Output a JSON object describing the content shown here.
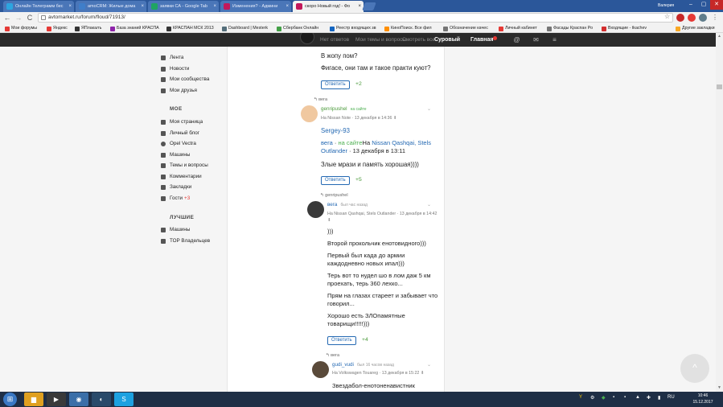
{
  "browser": {
    "tabs": [
      {
        "label": "Онлайн Телеграмм бес",
        "icon": "telegram-icon",
        "color": "#2ca5e0"
      },
      {
        "label": "amoCRM: Жилые дома",
        "icon": "amocrm-icon",
        "color": "#3f7ec9"
      },
      {
        "label": "заявки СА - Google Tab",
        "icon": "sheets-icon",
        "color": "#1fa463"
      },
      {
        "label": "Изменения? - Админи",
        "icon": "avtomarket-icon",
        "color": "#c2185b"
      },
      {
        "label": "скоро Новый год! - Фо",
        "icon": "avtomarket-icon",
        "color": "#c2185b"
      }
    ],
    "close_glyph": "×",
    "profile_name": "Валерия",
    "window_controls": [
      "–",
      "▢",
      "✕"
    ],
    "nav": {
      "back": "←",
      "forward": "→",
      "reload": "C"
    },
    "url": "avtomarket.ru/forum/floud/71913/",
    "star_glyph": "☆",
    "bookmarks": [
      {
        "label": "Мои форумы",
        "color": "#e53935"
      },
      {
        "label": "Яндекс",
        "color": "#e53935"
      },
      {
        "label": "ЯПлакалъ",
        "color": "#333333"
      },
      {
        "label": "База знаний КРАСПА",
        "color": "#8e24aa"
      },
      {
        "label": "КРАСПАН МСК 2013",
        "color": "#333333"
      },
      {
        "label": "Dashboard | Mesterk",
        "color": "#546e7a"
      },
      {
        "label": "Сбербанк Онлайн",
        "color": "#43a047"
      },
      {
        "label": "Реестр входящих зв",
        "color": "#1565c0"
      },
      {
        "label": "КиноПоиск. Все фил",
        "color": "#ff8f00"
      },
      {
        "label": "Обозначение качес",
        "color": "#757575"
      },
      {
        "label": "Личный кабинет",
        "color": "#e53935"
      },
      {
        "label": "Фасады Краспан Ро",
        "color": "#757575"
      },
      {
        "label": "Входящие - tkachev",
        "color": "#d32f2f"
      },
      {
        "label": "Другие закладки",
        "color": "#f9a825"
      }
    ]
  },
  "site": {
    "header": {
      "faded_links": [
        "Нет ответов",
        "Мои темы и вопросы",
        "Смотреть все"
      ],
      "user": "Суровый",
      "main": "Главная"
    },
    "sidebar": {
      "group1": [
        "Лента",
        "Новости",
        "Мои сообщества",
        "Мои друзья"
      ],
      "head_me": "МОЕ",
      "group2": [
        "Моя страница",
        "Личный блог",
        "Opel Vectra",
        "Машины",
        "Темы и вопросы",
        "Комментарии",
        "Закладки"
      ],
      "guests": {
        "label": "Гости",
        "count": "+3"
      },
      "head_best": "ЛУЧШИЕ",
      "group3": [
        "Машины",
        "ТОР Владельцев"
      ]
    },
    "comments": {
      "c0": {
        "line1": "В жопу пом?",
        "line2": "Фигасе, они там и такое практи куют?",
        "reply": "Ответить",
        "score": "+2"
      },
      "c1": {
        "reply_to": "вега",
        "author": "genripushel",
        "online": "на сайте",
        "meta_prefix": "На",
        "car": "Nissan Note",
        "date": "13 декабря в 14:36",
        "quote_user": "Sergey-93",
        "nested_user": "вега",
        "nested_online": "на сайте",
        "nested_prefix": "На",
        "nested_car": "Nissan Qashqai, Stels Outlander",
        "nested_date": "13 декабря в 13:11",
        "text": "Злые мрази и память хорошая))))",
        "reply": "Ответить",
        "score": "+5"
      },
      "c2": {
        "reply_to": "genripushel",
        "author": "вега",
        "status": "был час назад",
        "meta_prefix": "На",
        "car": "Nissan Qashqai, Stels Outlander",
        "date": "13 декабря в 14:42",
        "lines": [
          ")))",
          "Второй прокольчик енотовидного)))",
          "Первый был када до армии каждодневно новых ипал)))",
          "Терь вот то нудел шо в лом даж 5 км проехать, терь 360 лехко...",
          "Прям на глазах стареет и забывает что говорил...",
          "Хорошо есть ЗЛОпамятные товарищи!!!!!)))"
        ],
        "reply": "Ответить",
        "score": "+4"
      },
      "c3": {
        "reply_to": "вега",
        "author": "gudi_vudi",
        "status": "был 16 часов назад",
        "meta_prefix": "На",
        "car": "Volkswagen Touareg",
        "date": "13 декабря в 15:22",
        "text": "Звездабол-енотоненавистник"
      }
    }
  },
  "taskbar": {
    "start": "⊞",
    "apps": [
      {
        "icon": "explorer-icon",
        "color": "#e0a020",
        "glyph": "▆"
      },
      {
        "icon": "media-icon",
        "color": "#3a3a3a",
        "glyph": "▶"
      },
      {
        "icon": "chrome-icon",
        "color": "#3b6fa8",
        "glyph": "◉"
      },
      {
        "icon": "network-icon",
        "color": "#2a4a6a",
        "glyph": "◐"
      },
      {
        "icon": "skype-icon",
        "color": "#1da1e0",
        "glyph": "S"
      }
    ],
    "tray_glyphs": [
      "Y",
      "⚙",
      "◆",
      "▪",
      "▪",
      "▲",
      "✚",
      "▮"
    ],
    "language": "RU",
    "time": "10:46",
    "date": "15.12.2017"
  }
}
